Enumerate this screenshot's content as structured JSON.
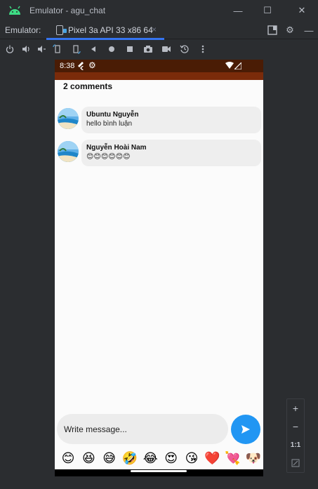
{
  "window": {
    "title": "Emulator - agu_chat",
    "minimize": "—",
    "maximize": "☐",
    "close": "✕"
  },
  "tabbar": {
    "label": "Emulator:",
    "device_tab": "Pixel 3a API 33 x86 64",
    "close_tab": "×"
  },
  "phone": {
    "status_time": "8:38",
    "comments_heading": "2 comments",
    "comments": [
      {
        "name": "Ubuntu Nguyễn",
        "text": "hello bình luận"
      },
      {
        "name": "Nguyễn Hoài Nam",
        "text": "😊😊😊😊😊😊"
      }
    ],
    "input_placeholder": "Write message...",
    "emojis": [
      "😊",
      "😆",
      "😅",
      "🤣",
      "😂",
      "😍",
      "😘",
      "❤️",
      "💘",
      "🐶"
    ]
  },
  "zoom": {
    "zoom_in": "+",
    "zoom_out": "−",
    "one_to_one": "1:1"
  },
  "colors": {
    "status_bar": "#4a1c05",
    "app_bar": "#7a2b0a",
    "send_button": "#2196f3",
    "tab_accent": "#3574f0"
  }
}
